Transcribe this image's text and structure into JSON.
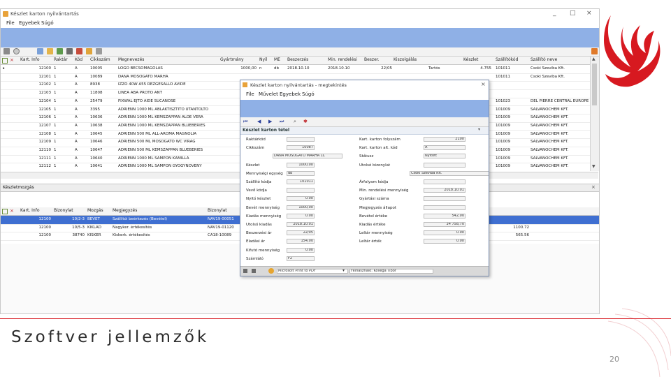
{
  "window": {
    "title": "Készlet karton nyilvántartás",
    "menu": [
      "File",
      "Egyebek",
      "Súgó"
    ],
    "controls": [
      "_",
      "□",
      "×"
    ]
  },
  "main_table": {
    "headers": [
      "Kart. Info",
      "Raktár",
      "Kód",
      "Cikkszám",
      "Megnevezés",
      "Gyártmány",
      "Nyil",
      "ME",
      "Beszerzés",
      "Min. rendelési",
      "Beszer.",
      "Kiszolgálás",
      "Készlet",
      "Szállítókód",
      "Szállító neve"
    ],
    "rows": [
      [
        "12100",
        "1",
        "A",
        "10005",
        "LOGO BECSOMAGOLÁS",
        "1000,00",
        "n",
        "db",
        "2018.10.10",
        "2018.10.10",
        "22/05",
        "",
        "Tartós",
        "4.755",
        "101011",
        "Csoki Szeviba Kft."
      ],
      [
        "12101",
        "1",
        "A",
        "10089",
        "DANA MOSOGATÓ MARHA",
        "",
        "",
        "",
        "",
        "",
        "",
        "",
        "",
        "",
        "101011",
        "Csoki Szeviba Kft."
      ],
      [
        "12102",
        "1",
        "A",
        "8938",
        "IZZO 40W A55 REZGESÁLLÓ AVIDE",
        "",
        "",
        "",
        "",
        "",
        "",
        "",
        "",
        "",
        "",
        ""
      ],
      [
        "12103",
        "1",
        "A",
        "11808",
        "LINEA ABA PROTO ANT",
        "",
        "",
        "",
        "",
        "",
        "",
        "",
        "",
        "",
        "",
        ""
      ],
      [
        "12104",
        "1",
        "A",
        "25479",
        "FIXWAL EJTO AIDE SUCANOSE",
        "",
        "",
        "",
        "",
        "",
        "",
        "",
        "",
        "",
        "101023",
        "DEL PIERRE CENTRAL EUROPE"
      ],
      [
        "12105",
        "1",
        "A",
        "3395",
        "ADRIENN 1000 ML ABLAKTISZTÍTÓ UTÁNTÖLTŐ",
        "",
        "",
        "",
        "",
        "",
        "",
        "",
        "",
        "",
        "101009",
        "SALVANOCHEM KFT."
      ],
      [
        "12106",
        "1",
        "A",
        "10636",
        "ADRIENN 1000 ML KÉMSZAPPAN ALOE VERA",
        "",
        "",
        "",
        "",
        "",
        "",
        "",
        "",
        "",
        "101009",
        "SALVANOCHEM KFT."
      ],
      [
        "12107",
        "1",
        "A",
        "10638",
        "ADRIENN 1000 ML KÉMSZAPPAN BLUEBERIES",
        "",
        "",
        "",
        "",
        "",
        "",
        "",
        "",
        "",
        "101009",
        "SALVANOCHEM KFT."
      ],
      [
        "12108",
        "1",
        "A",
        "10645",
        "ADRIENN 500 ML ALL-AROMA MAGNÓLIA",
        "",
        "",
        "",
        "",
        "",
        "",
        "",
        "",
        "",
        "101009",
        "SALVANOCHEM KFT."
      ],
      [
        "12109",
        "1",
        "A",
        "10646",
        "ADRIENN 500 ML MOSOGATÓ WC VIRÁG",
        "",
        "",
        "",
        "",
        "",
        "",
        "",
        "",
        "",
        "101009",
        "SALVANOCHEM KFT."
      ],
      [
        "12110",
        "1",
        "A",
        "10647",
        "ADRIENN 500 ML KÉMSZAPPAN BLUEBERIES",
        "",
        "",
        "",
        "",
        "",
        "",
        "",
        "",
        "",
        "101009",
        "SALVANOCHEM KFT."
      ],
      [
        "12111",
        "1",
        "A",
        "10640",
        "ADRIENN 1000 ML SAMPON KAMILLA",
        "",
        "",
        "",
        "",
        "",
        "",
        "",
        "",
        "",
        "101009",
        "SALVANOCHEM KFT."
      ],
      [
        "12112",
        "1",
        "A",
        "10641",
        "ADRIENN 1000 ML SAMPON GYÓGYNÖVÉNY",
        "",
        "",
        "",
        "",
        "",
        "",
        "",
        "",
        "",
        "101009",
        "SALVANOCHEM KFT."
      ]
    ]
  },
  "lower_section": {
    "title": "Készletmozgás",
    "headers": [
      "Kart. Info",
      "Bizonylat",
      "Mozgás",
      "Megjegyzés",
      "Bizonylat"
    ],
    "rows": [
      [
        "12100",
        "10/2-3",
        "BEVÉT",
        "Szállítói beérkezés (Bevétel)",
        "NAV19-00051",
        "",
        "sel"
      ],
      [
        "12100",
        "10/5-3",
        "KIKLAD",
        "Nagyker. értékesítés",
        "NAV19-01120",
        "1100.72",
        ""
      ],
      [
        "12100",
        "38740",
        "KISKER",
        "Kiskerk. értékesítés",
        "CA18-10089",
        "565.56",
        ""
      ]
    ]
  },
  "dialog": {
    "title": "Készlet karton nyilvántartás - megtekintés",
    "menu": [
      "File",
      "Művelet",
      "Egyebek",
      "Súgó"
    ],
    "section": "Készlet karton tétel",
    "left_fields": [
      {
        "label": "Raktárkód",
        "value": ""
      },
      {
        "label": "Cikkszám",
        "value": "10087"
      },
      {
        "label": "",
        "value": "DANA MOSOGATÓ MARHA 1L"
      },
      {
        "label": "Készlet",
        "value": "1000,00"
      },
      {
        "label": "Mennyiségi egység",
        "value": "db"
      },
      {
        "label": "Szállító kódja",
        "value": "101011"
      },
      {
        "label": "Vevő kódja",
        "value": ""
      },
      {
        "label": "Nyitó készlet",
        "value": "0.00"
      },
      {
        "label": "Bevét mennyiség",
        "value": "1000,00"
      },
      {
        "label": "Kiadás mennyiség",
        "value": "0.00"
      },
      {
        "label": "Utolsó kiadás",
        "value": "2018.10.01"
      },
      {
        "label": "Beszerzési ár",
        "value": "22/05"
      },
      {
        "label": "Eladási ár",
        "value": "154,00"
      },
      {
        "label": "Kifutó mennyiség",
        "value": "0.00"
      },
      {
        "label": "Számláló",
        "value": "F2"
      }
    ],
    "right_fields": [
      {
        "label": "Kart. karton folyszám",
        "value": "2100"
      },
      {
        "label": "Kart. karton alt. kód",
        "value": "A"
      },
      {
        "label": "Státusz",
        "value": "Nyitott"
      },
      {
        "label": "Utolsó bizonylat",
        "value": ""
      },
      {
        "label": "",
        "value": "Csoki Szeviba Kft."
      },
      {
        "label": "Árfolyam kódja",
        "value": ""
      },
      {
        "label": "Min. rendelési mennyiség",
        "value": "2018.10.01"
      },
      {
        "label": "Gyártási száma",
        "value": ""
      },
      {
        "label": "Megjegyzés állapot",
        "value": ""
      },
      {
        "label": "Bevétel értéke",
        "value": "542,00"
      },
      {
        "label": "Kiadás értéke",
        "value": "34 758,70"
      },
      {
        "label": "Leltár mennyiség",
        "value": "0.00"
      },
      {
        "label": "Leltár érték",
        "value": "0.00"
      }
    ],
    "status": {
      "printer": "Microsoft Print to PDF",
      "user": "Felhasználó: Kollega Tibor"
    }
  },
  "slide": {
    "title": "Szoftver jellemzők",
    "page": "20"
  },
  "colors": {
    "accent": "#d71920",
    "band": "#8fb0e6",
    "selection": "#3f6fd1"
  }
}
